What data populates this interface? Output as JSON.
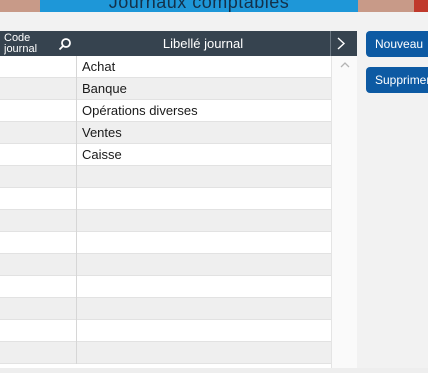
{
  "window": {
    "title": "Journaux comptables"
  },
  "grid": {
    "columns": {
      "code": "Code\njournal",
      "label": "Libellé journal"
    },
    "rows": [
      {
        "code": "",
        "label": "Achat"
      },
      {
        "code": "",
        "label": "Banque"
      },
      {
        "code": "",
        "label": "Opérations diverses"
      },
      {
        "code": "",
        "label": "Ventes"
      },
      {
        "code": "",
        "label": "Caisse"
      },
      {
        "code": "",
        "label": ""
      },
      {
        "code": "",
        "label": ""
      },
      {
        "code": "",
        "label": ""
      },
      {
        "code": "",
        "label": ""
      },
      {
        "code": "",
        "label": ""
      },
      {
        "code": "",
        "label": ""
      },
      {
        "code": "",
        "label": ""
      },
      {
        "code": "",
        "label": ""
      },
      {
        "code": "",
        "label": ""
      }
    ]
  },
  "actions": {
    "new_label": "Nouveau",
    "delete_label": "Supprimer"
  },
  "icons": {
    "search": "search-icon",
    "chevron": "chevron-right-icon",
    "scroll_up": "chevron-up-icon"
  },
  "colors": {
    "header_bg": "#36434f",
    "button_bg": "#0d5aa3",
    "title_bg": "#1e97d8"
  }
}
